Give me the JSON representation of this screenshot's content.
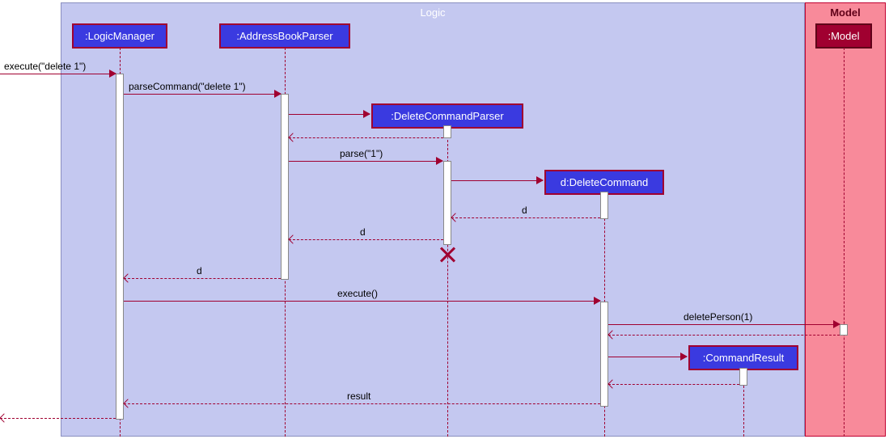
{
  "boxes": {
    "logic_title": "Logic",
    "model_title": "Model"
  },
  "participants": {
    "logic_manager": ":LogicManager",
    "address_book_parser": ":AddressBookParser",
    "delete_command_parser": ":DeleteCommandParser",
    "delete_command": "d:DeleteCommand",
    "command_result": ":CommandResult",
    "model": ":Model"
  },
  "messages": {
    "execute_delete1": "execute(\"delete 1\")",
    "parse_command": "parseCommand(\"delete 1\")",
    "parse_1": "parse(\"1\")",
    "return_d_1": "d",
    "return_d_2": "d",
    "return_d_3": "d",
    "execute": "execute()",
    "delete_person": "deletePerson(1)",
    "result": "result"
  }
}
